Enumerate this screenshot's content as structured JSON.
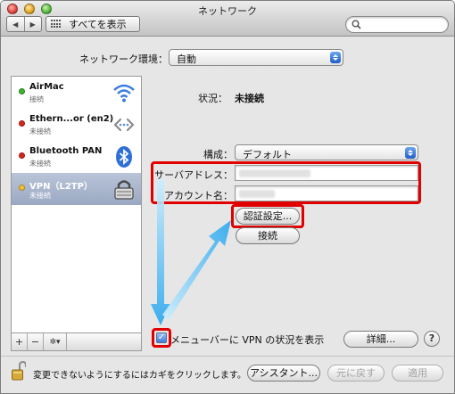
{
  "window": {
    "title": "ネットワーク"
  },
  "toolbar": {
    "back_glyph": "◀",
    "forward_glyph": "▶",
    "show_all_label": "すべてを表示",
    "search_placeholder": ""
  },
  "location": {
    "label": "ネットワーク環境：",
    "value": "自動"
  },
  "services": [
    {
      "name": "AirMac",
      "status": "接続",
      "status_color": "#3cb62c",
      "icon": "wifi-icon"
    },
    {
      "name": "Ethern...or (en2)",
      "status": "未接続",
      "status_color": "#d9261c",
      "icon": "ethernet-icon"
    },
    {
      "name": "Bluetooth PAN",
      "status": "未接続",
      "status_color": "#d9261c",
      "icon": "bluetooth-icon"
    },
    {
      "name": "VPN（L2TP）",
      "status": "未接続",
      "status_color": "#f2c230",
      "icon": "vpn-lock-icon",
      "selected": true
    }
  ],
  "sidebar_buttons": {
    "add": "+",
    "remove": "−",
    "action": "✲▾"
  },
  "detail": {
    "status_label": "状況：",
    "status_value": "未接続",
    "config_label": "構成：",
    "config_value": "デフォルト",
    "server_label": "サーバアドレス：",
    "account_label": "アカウント名：",
    "auth_button": "認証設定...",
    "connect_button": "接続",
    "menubar_checkbox_label": "メニューバーに VPN の状況を表示",
    "menubar_checked": "✓",
    "advanced_button": "詳細...",
    "help_glyph": "?"
  },
  "footer": {
    "lock_text": "変更できないようにするにはカギをクリックします。",
    "assistant_button": "アシスタント...",
    "revert_button": "元に戻す",
    "apply_button": "適用"
  },
  "colors": {
    "highlight_red": "#e00000",
    "arrow_blue": "#3ab3f0"
  }
}
